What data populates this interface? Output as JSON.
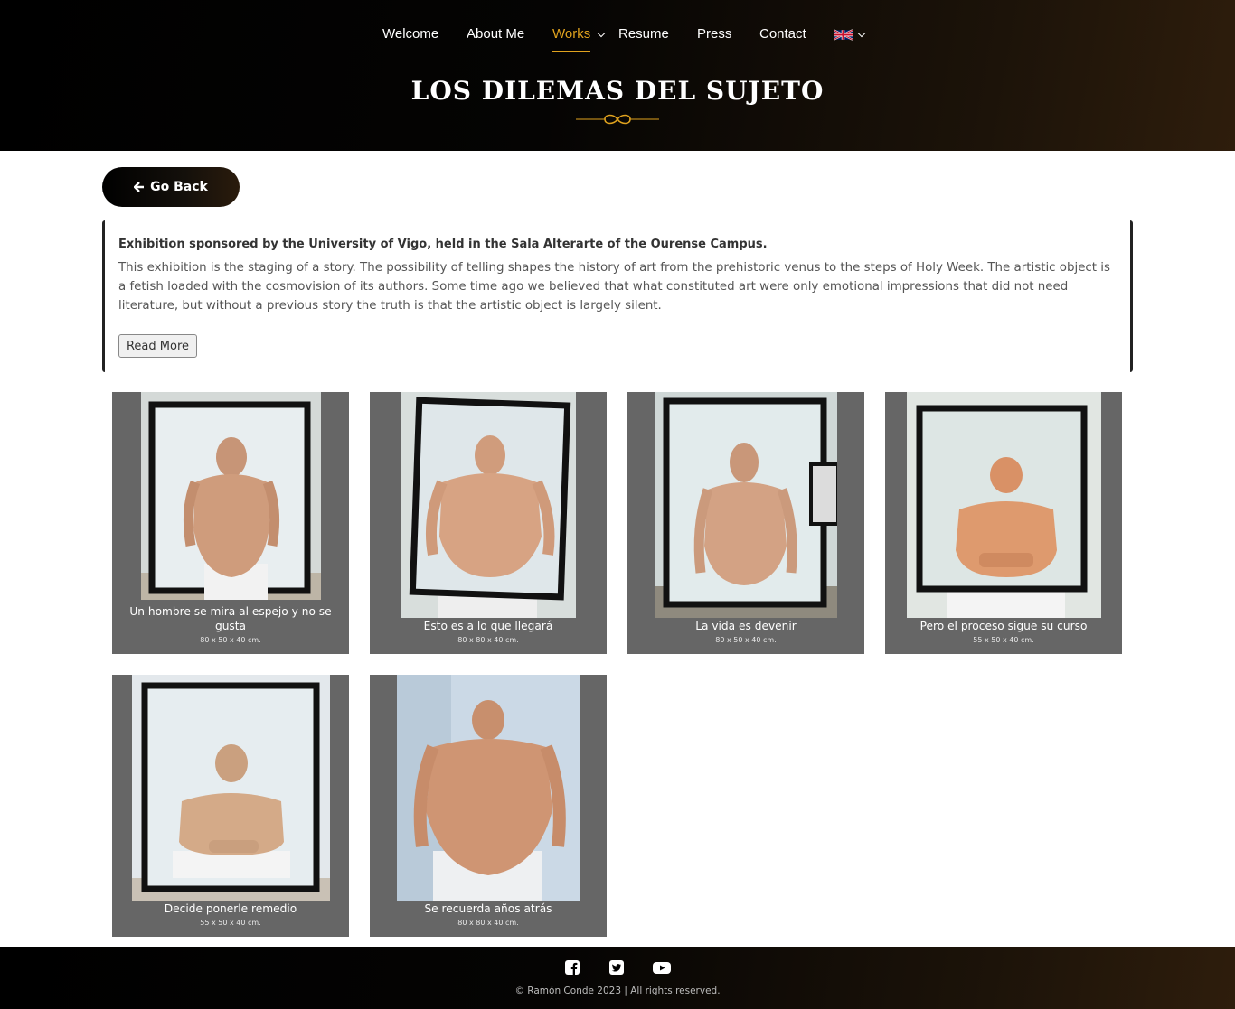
{
  "nav": {
    "items": [
      {
        "label": "Welcome"
      },
      {
        "label": "About Me"
      },
      {
        "label": "Works"
      },
      {
        "label": "Resume"
      },
      {
        "label": "Press"
      },
      {
        "label": "Contact"
      }
    ],
    "active": "Works",
    "accent_color": "#e0a21e",
    "language_icon": "uk-flag-icon"
  },
  "page_title": "LOS DILEMAS DEL SUJETO",
  "go_back_label": "Go Back",
  "intro": {
    "title": "Exhibition sponsored by the University of Vigo, held in the Sala Alterarte of the Ourense Campus.",
    "text": "This exhibition is the staging of a story. The possibility of telling shapes the history of art from the prehistoric venus to the steps of Holy Week. The artistic object is a fetish loaded with the cosmovision of its authors. Some time ago we believed that what constituted art were only emotional impressions that did not need literature, but without a previous story the truth is that the artistic object is largely silent.",
    "read_more_label": "Read More"
  },
  "works": [
    {
      "title": "Un hombre se mira al espejo y no se gusta",
      "dimensions": "80 x 50 x 40 cm."
    },
    {
      "title": "Esto es a lo que llegará",
      "dimensions": "80 x 80 x 40 cm."
    },
    {
      "title": "La vida es devenir",
      "dimensions": "80 x 50 x 40 cm."
    },
    {
      "title": "Pero el proceso sigue su curso",
      "dimensions": "55 x 50 x 40 cm."
    },
    {
      "title": "Decide ponerle remedio",
      "dimensions": "55 x 50 x 40 cm."
    },
    {
      "title": "Se recuerda años atrás",
      "dimensions": "80 x 80 x 40 cm."
    }
  ],
  "footer": {
    "social_icons": [
      "facebook-icon",
      "twitter-icon",
      "youtube-icon"
    ],
    "copyright": "© Ramón Conde 2023 | All rights reserved."
  }
}
